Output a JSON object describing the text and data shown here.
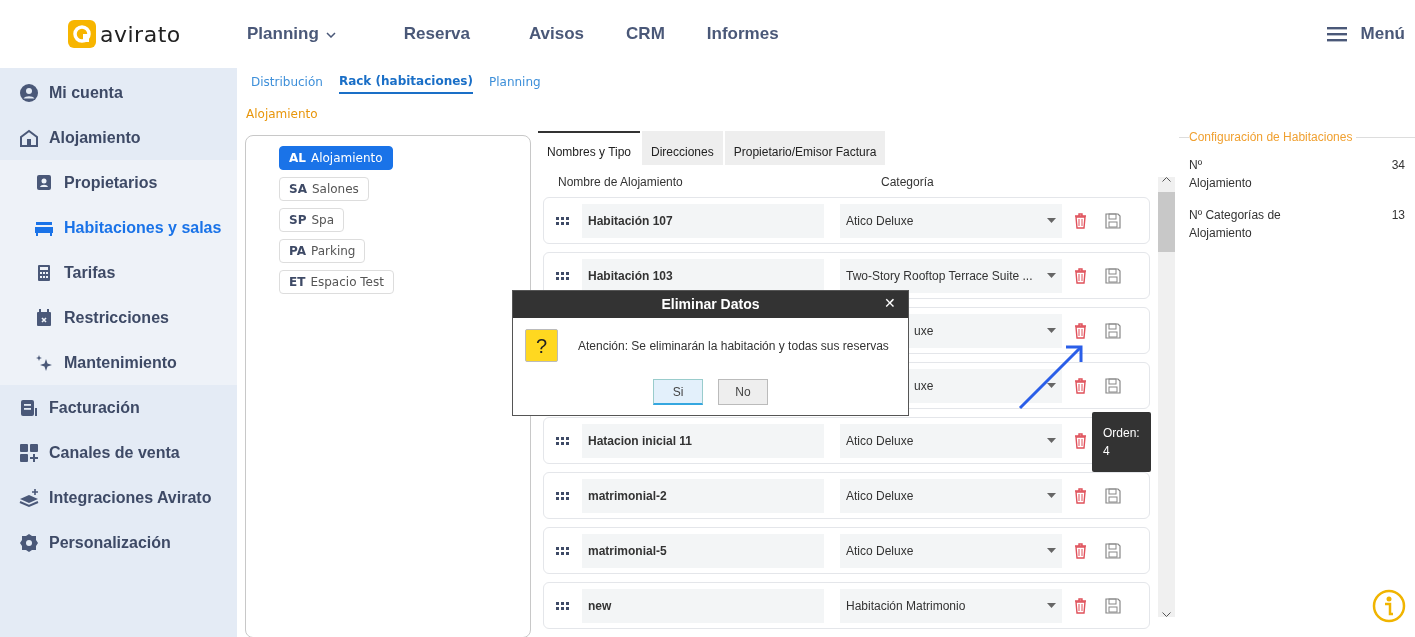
{
  "brand": {
    "name": "avirato"
  },
  "top_nav": [
    {
      "label": "Planning",
      "dropdown": true
    },
    {
      "label": "Reserva",
      "dropdown": false
    },
    {
      "label": "Avisos",
      "dropdown": false
    },
    {
      "label": "CRM",
      "dropdown": false
    },
    {
      "label": "Informes",
      "dropdown": false
    }
  ],
  "menu_button": {
    "label": "Menú"
  },
  "sidebar": {
    "items": [
      {
        "label": "Mi cuenta",
        "kind": "top",
        "selected": false
      },
      {
        "label": "Alojamiento",
        "kind": "top",
        "selected": false
      },
      {
        "label": "Propietarios",
        "kind": "sub",
        "selected": false
      },
      {
        "label": "Habitaciones y salas",
        "kind": "sub",
        "selected": true
      },
      {
        "label": "Tarifas",
        "kind": "sub",
        "selected": false
      },
      {
        "label": "Restricciones",
        "kind": "sub",
        "selected": false
      },
      {
        "label": "Mantenimiento",
        "kind": "sub",
        "selected": false
      },
      {
        "label": "Facturación",
        "kind": "top",
        "selected": false
      },
      {
        "label": "Canales de venta",
        "kind": "top",
        "selected": false
      },
      {
        "label": "Integraciones Avirato",
        "kind": "top",
        "selected": false
      },
      {
        "label": "Personalización",
        "kind": "top",
        "selected": false
      }
    ]
  },
  "sub_tabs": [
    {
      "label": "Distribución",
      "selected": false
    },
    {
      "label": "Rack (habitaciones)",
      "selected": true
    },
    {
      "label": "Planning",
      "selected": false
    }
  ],
  "section_label": "Alojamiento",
  "types": [
    {
      "code": "AL",
      "label": "Alojamiento",
      "selected": true
    },
    {
      "code": "SA",
      "label": "Salones",
      "selected": false
    },
    {
      "code": "SP",
      "label": "Spa",
      "selected": false
    },
    {
      "code": "PA",
      "label": "Parking",
      "selected": false
    },
    {
      "code": "ET",
      "label": "Espacio Test",
      "selected": false
    }
  ],
  "panel_tabs": [
    {
      "label": "Nombres y  Tipo",
      "selected": true
    },
    {
      "label": "Direcciones",
      "selected": false
    },
    {
      "label": "Propietario/Emisor Factura",
      "selected": false
    }
  ],
  "table": {
    "columns": [
      "Nombre de  Alojamiento",
      "Categoría"
    ],
    "rows": [
      {
        "name": "Habitación 107",
        "category": "Atico Deluxe",
        "covered": false
      },
      {
        "name": "Habitación 103",
        "category": "Two-Story Rooftop Terrace Suite ...",
        "covered": false
      },
      {
        "category": "uxe",
        "covered": true
      },
      {
        "category": "uxe",
        "covered": true
      },
      {
        "name": "Hatacion inicial 11",
        "category": "Atico Deluxe",
        "covered": false,
        "tooltip": "Orden: 4"
      },
      {
        "name": "matrimonial-2",
        "category": "Atico Deluxe",
        "covered": false
      },
      {
        "name": "matrimonial-5",
        "category": "Atico Deluxe",
        "covered": false
      },
      {
        "name": "new",
        "category": "Habitación Matrimonio",
        "covered": false
      }
    ]
  },
  "config": {
    "title": "Configuración de Habitaciones",
    "stats": [
      {
        "label": "Nº Alojamiento",
        "value": "34"
      },
      {
        "label": "Nº Categorías de Alojamiento",
        "value": "13"
      }
    ]
  },
  "dialog": {
    "title": "Eliminar Datos",
    "close": "✕",
    "message": "Atención: Se eliminarán la habitación y todas sus reservas",
    "icon": "?",
    "buttons": [
      {
        "label": "Si",
        "selected": true
      },
      {
        "label": "No",
        "selected": false
      }
    ]
  }
}
